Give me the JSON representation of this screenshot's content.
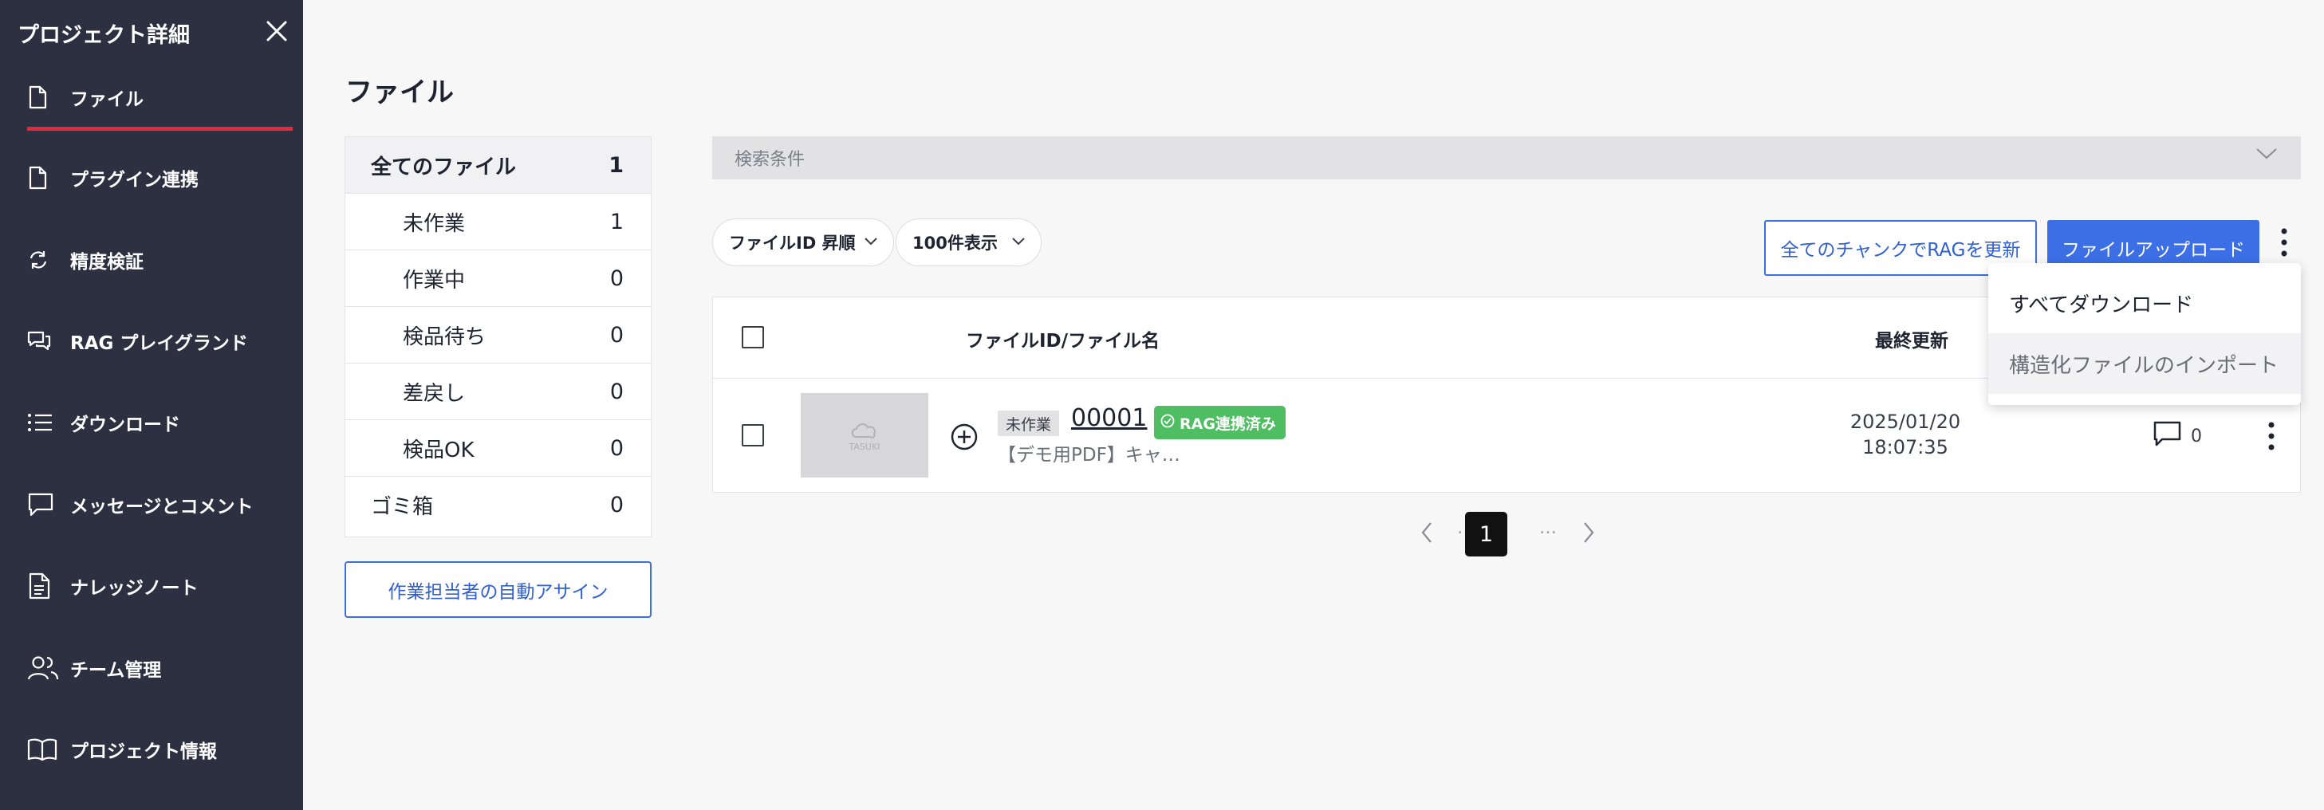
{
  "colors": {
    "sidebar_bg": "#2c3040",
    "active_underline": "#e0293d",
    "primary": "#3c6fe6",
    "rag_tag": "#4fbd62"
  },
  "sidebar": {
    "title": "プロジェクト詳細",
    "items": [
      {
        "label": "ファイル",
        "icon": "file-icon"
      },
      {
        "label": "プラグイン連携",
        "icon": "file-icon"
      },
      {
        "label": "精度検証",
        "icon": "refresh-icon"
      },
      {
        "label": "RAG プレイグランド",
        "icon": "chat-icon"
      },
      {
        "label": "ダウンロード",
        "icon": "list-icon"
      },
      {
        "label": "メッセージとコメント",
        "icon": "message-icon"
      },
      {
        "label": "ナレッジノート",
        "icon": "document-icon"
      },
      {
        "label": "チーム管理",
        "icon": "users-icon"
      },
      {
        "label": "プロジェクト情報",
        "icon": "book-icon"
      }
    ]
  },
  "main": {
    "title": "ファイル",
    "status_list": {
      "all": {
        "label": "全てのファイル",
        "count": "1"
      },
      "items": [
        {
          "label": "未作業",
          "count": "1"
        },
        {
          "label": "作業中",
          "count": "0"
        },
        {
          "label": "検品待ち",
          "count": "0"
        },
        {
          "label": "差戻し",
          "count": "0"
        },
        {
          "label": "検品OK",
          "count": "0"
        }
      ],
      "trash": {
        "label": "ゴミ箱",
        "count": "0"
      }
    },
    "auto_assign_label": "作業担当者の自動アサイン",
    "search_conditions_label": "検索条件",
    "sort_select": "ファイルID 昇順",
    "page_size_select": "100件表示",
    "update_rag_button": "全てのチャンクでRAGを更新",
    "upload_button": "ファイルアップロード",
    "table": {
      "headers": {
        "file": "ファイルID/ファイル名",
        "updated": "最終更新"
      },
      "rows": [
        {
          "thumbnail_text": "TASUKI",
          "status": "未作業",
          "file_id": "00001",
          "rag_badge": "RAG連携済み",
          "file_name": "【デモ用PDF】キャ…",
          "updated_date": "2025/01/20",
          "updated_time": "18:07:35",
          "comment_count": "0"
        }
      ]
    },
    "pagination": {
      "current": "1",
      "dots_left": "…",
      "dots_right": "…"
    },
    "menu": {
      "items": [
        {
          "label": "すべてダウンロード"
        },
        {
          "label": "構造化ファイルのインポート"
        }
      ]
    }
  }
}
